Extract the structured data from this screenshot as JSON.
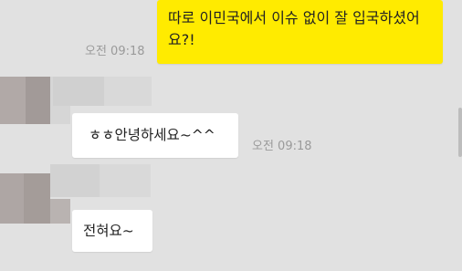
{
  "messages": [
    {
      "direction": "out",
      "text": "따로 이민국에서 이슈 없이 잘 입국하셨어요?!",
      "time": "오전 09:18"
    },
    {
      "direction": "in",
      "text": "ㅎㅎ안녕하세요~^^",
      "time": "오전 09:18"
    },
    {
      "direction": "in",
      "text": "전혀요~"
    }
  ],
  "colors": {
    "background": "#e1e1e1",
    "outgoing_bubble": "#ffeb00",
    "incoming_bubble": "#ffffff",
    "timestamp": "#9a9a9a"
  }
}
